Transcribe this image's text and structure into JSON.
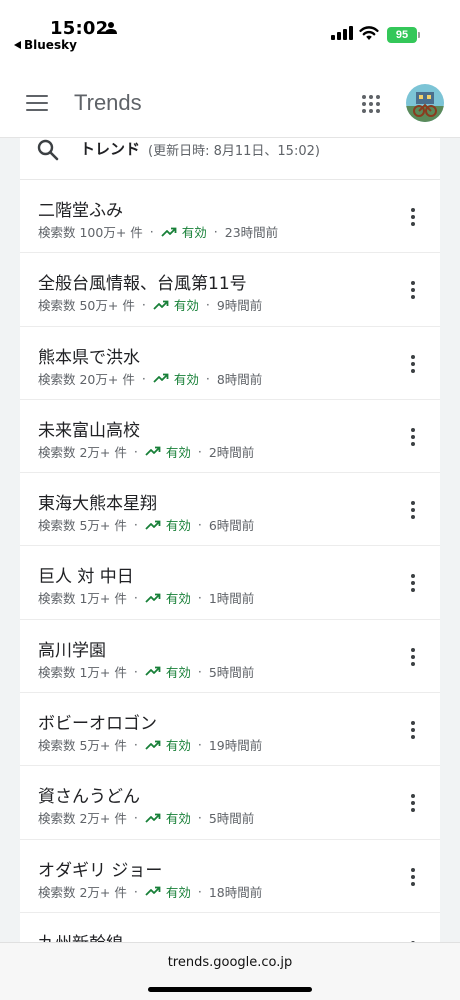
{
  "status_bar": {
    "time": "15:02",
    "back_app": "Bluesky",
    "battery": "95"
  },
  "header": {
    "title": "Trends"
  },
  "search": {
    "title": "トレンド",
    "meta": "(更新日時: 8月11日、15:02)"
  },
  "trends": [
    {
      "title": "二階堂ふみ",
      "searches": "検索数 100万+ 件",
      "status": "有効",
      "time": "23時間前"
    },
    {
      "title": "全般台風情報、台風第11号",
      "searches": "検索数 50万+ 件",
      "status": "有効",
      "time": "9時間前"
    },
    {
      "title": "熊本県で洪水",
      "searches": "検索数 20万+ 件",
      "status": "有効",
      "time": "8時間前"
    },
    {
      "title": "未来富山高校",
      "searches": "検索数 2万+ 件",
      "status": "有効",
      "time": "2時間前"
    },
    {
      "title": "東海大熊本星翔",
      "searches": "検索数 5万+ 件",
      "status": "有効",
      "time": "6時間前"
    },
    {
      "title": "巨人 対 中日",
      "searches": "検索数 1万+ 件",
      "status": "有効",
      "time": "1時間前"
    },
    {
      "title": "高川学園",
      "searches": "検索数 1万+ 件",
      "status": "有効",
      "time": "5時間前"
    },
    {
      "title": "ボビーオロゴン",
      "searches": "検索数 5万+ 件",
      "status": "有効",
      "time": "19時間前"
    },
    {
      "title": "資さんうどん",
      "searches": "検索数 2万+ 件",
      "status": "有効",
      "time": "5時間前"
    },
    {
      "title": "オダギリ ジョー",
      "searches": "検索数 2万+ 件",
      "status": "有効",
      "time": "18時間前"
    },
    {
      "title": "九州新幹線",
      "searches": "",
      "status": "",
      "time": ""
    }
  ],
  "url_bar": {
    "url": "trends.google.co.jp"
  },
  "colors": {
    "active_green": "#188038",
    "battery_green": "#34c759",
    "text_secondary": "#5f6368"
  },
  "icons": [
    "person-icon",
    "back-arrow-icon",
    "signal-icon",
    "wifi-icon",
    "battery-icon",
    "menu-icon",
    "apps-grid-icon",
    "avatar",
    "search-icon",
    "trending-up-icon",
    "more-vert-icon"
  ]
}
